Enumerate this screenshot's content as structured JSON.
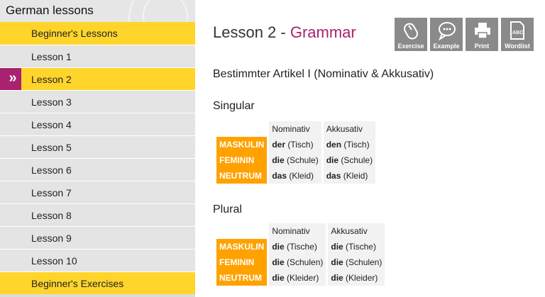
{
  "sidebar": {
    "title": "German lessons",
    "items": [
      {
        "label": "Beginner's Lessons",
        "yellow": true
      },
      {
        "label": "Lesson 1"
      },
      {
        "label": "Lesson 2",
        "active": true
      },
      {
        "label": "Lesson 3"
      },
      {
        "label": "Lesson 4"
      },
      {
        "label": "Lesson 5"
      },
      {
        "label": "Lesson 6"
      },
      {
        "label": "Lesson 7"
      },
      {
        "label": "Lesson 8"
      },
      {
        "label": "Lesson 9"
      },
      {
        "label": "Lesson 10"
      },
      {
        "label": "Beginner's Exercises",
        "yellow": true
      }
    ],
    "active_marker": "»"
  },
  "main": {
    "title_prefix": "Lesson 2 - ",
    "title_accent": "Grammar",
    "subtitle": "Bestimmter Artikel I (Nominativ & Akkusativ)",
    "toolbar": [
      {
        "label": "Exercise",
        "icon": "mouse-icon"
      },
      {
        "label": "Example",
        "icon": "speech-bubble-icon"
      },
      {
        "label": "Print",
        "icon": "printer-icon"
      },
      {
        "label": "Wordlist",
        "icon": "document-abc-icon"
      }
    ],
    "singular": {
      "heading": "Singular",
      "col1": "Nominativ",
      "col2": "Akkusativ",
      "rows": [
        {
          "gender": "MASKULIN",
          "nom_art": "der",
          "nom_noun": " (Tisch)",
          "akk_art": "den",
          "akk_noun": " (Tisch)"
        },
        {
          "gender": "FEMININ",
          "nom_art": "die",
          "nom_noun": " (Schule)",
          "akk_art": "die",
          "akk_noun": " (Schule)"
        },
        {
          "gender": "NEUTRUM",
          "nom_art": "das",
          "nom_noun": " (Kleid)",
          "akk_art": "das",
          "akk_noun": " (Kleid)"
        }
      ]
    },
    "plural": {
      "heading": "Plural",
      "col1": "Nominativ",
      "col2": "Akkusativ",
      "rows": [
        {
          "gender": "MASKULIN",
          "nom_art": "die",
          "nom_noun": " (Tische)",
          "akk_art": "die",
          "akk_noun": " (Tische)"
        },
        {
          "gender": "FEMININ",
          "nom_art": "die",
          "nom_noun": " (Schulen)",
          "akk_art": "die",
          "akk_noun": " (Schulen)"
        },
        {
          "gender": "NEUTRUM",
          "nom_art": "die",
          "nom_noun": " (Kleider)",
          "akk_art": "die",
          "akk_noun": " (Kleider)"
        }
      ]
    }
  },
  "colors": {
    "accent": "#a8226f",
    "yellow": "#ffd52b",
    "gender_badge": "#ffa200",
    "toolbar_button": "#8a8a8a"
  }
}
